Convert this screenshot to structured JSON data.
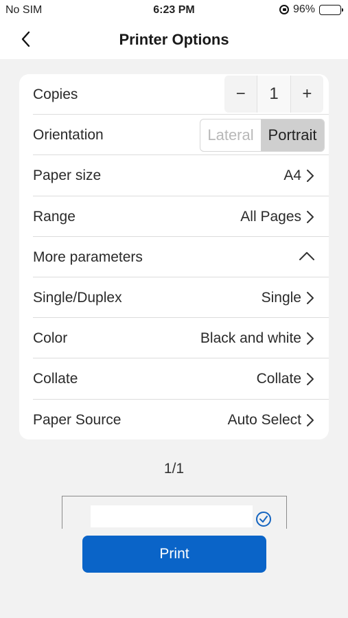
{
  "status": {
    "carrier": "No SIM",
    "time": "6:23 PM",
    "battery": "96%",
    "battery_level": 0.96
  },
  "nav": {
    "title": "Printer Options",
    "back_icon": "chevron-left-icon"
  },
  "options": {
    "copies": {
      "label": "Copies",
      "value": "1",
      "minus": "−",
      "plus": "+"
    },
    "orientation": {
      "label": "Orientation",
      "options": [
        "Lateral",
        "Portrait"
      ],
      "selected": "Portrait"
    },
    "paper_size": {
      "label": "Paper size",
      "value": "A4"
    },
    "range": {
      "label": "Range",
      "value": "All Pages"
    },
    "more": {
      "label": "More parameters",
      "expanded": true
    },
    "duplex": {
      "label": "Single/Duplex",
      "value": "Single"
    },
    "color": {
      "label": "Color",
      "value": "Black and white"
    },
    "collate": {
      "label": "Collate",
      "value": "Collate"
    },
    "paper_source": {
      "label": "Paper Source",
      "value": "Auto Select"
    }
  },
  "preview": {
    "page_count": "1/1",
    "selected": true
  },
  "print_button": "Print",
  "colors": {
    "accent": "#0a64c8",
    "background": "#f2f2f2"
  }
}
